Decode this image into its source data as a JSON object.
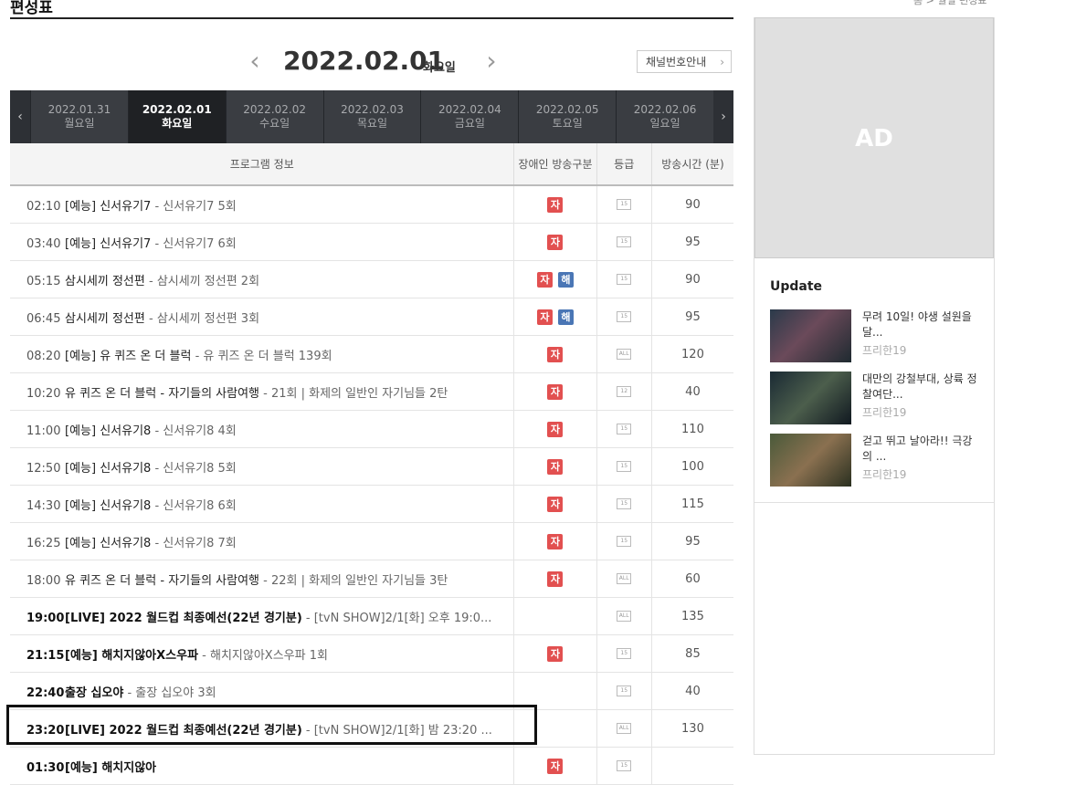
{
  "header": {
    "title": "편성표",
    "breadcrumb": "홈 > 월별 편성표"
  },
  "date_nav": {
    "prev": "‹",
    "next": "›",
    "date": "2022.02.01",
    "dow": "화요일",
    "channel_button": "채널번호안내",
    "channel_chev": "›"
  },
  "day_tabs": {
    "prev": "‹",
    "next": "›",
    "items": [
      {
        "date": "2022.01.31",
        "dow": "월요일"
      },
      {
        "date": "2022.02.01",
        "dow": "화요일"
      },
      {
        "date": "2022.02.02",
        "dow": "수요일"
      },
      {
        "date": "2022.02.03",
        "dow": "목요일"
      },
      {
        "date": "2022.02.04",
        "dow": "금요일"
      },
      {
        "date": "2022.02.05",
        "dow": "토요일"
      },
      {
        "date": "2022.02.06",
        "dow": "일요일"
      }
    ]
  },
  "table": {
    "headers": [
      "프로그램 정보",
      "장애인 방송구분",
      "등급",
      "방송시간 (분)"
    ],
    "rows": [
      {
        "time": "02:10",
        "title": "[예능] 신서유기7",
        "desc": " - 신서유기7 5회",
        "ja": "자",
        "hae": "",
        "rating": "15",
        "dur": "90"
      },
      {
        "time": "03:40",
        "title": "[예능] 신서유기7",
        "desc": " - 신서유기7 6회",
        "ja": "자",
        "hae": "",
        "rating": "15",
        "dur": "95"
      },
      {
        "time": "05:15",
        "title": "삼시세끼 정선편",
        "desc": " - 삼시세끼 정선편 2회",
        "ja": "자",
        "hae": "해",
        "rating": "15",
        "dur": "90"
      },
      {
        "time": "06:45",
        "title": "삼시세끼 정선편",
        "desc": " - 삼시세끼 정선편 3회",
        "ja": "자",
        "hae": "해",
        "rating": "15",
        "dur": "95"
      },
      {
        "time": "08:20",
        "title": "[예능] 유 퀴즈 온 더 블럭",
        "desc": " - 유 퀴즈 온 더 블럭 139회",
        "ja": "자",
        "hae": "",
        "rating": "ALL",
        "dur": "120"
      },
      {
        "time": "10:20",
        "title": "유 퀴즈 온 더 블럭 - 자기들의 사람여행",
        "desc": " - 21회 | 화제의 일반인 자기님들 2탄",
        "ja": "자",
        "hae": "",
        "rating": "12",
        "dur": "40"
      },
      {
        "time": "11:00",
        "title": "[예능] 신서유기8",
        "desc": " - 신서유기8 4회",
        "ja": "자",
        "hae": "",
        "rating": "15",
        "dur": "110"
      },
      {
        "time": "12:50",
        "title": "[예능] 신서유기8",
        "desc": " - 신서유기8 5회",
        "ja": "자",
        "hae": "",
        "rating": "15",
        "dur": "100"
      },
      {
        "time": "14:30",
        "title": "[예능] 신서유기8",
        "desc": " - 신서유기8 6회",
        "ja": "자",
        "hae": "",
        "rating": "15",
        "dur": "115"
      },
      {
        "time": "16:25",
        "title": "[예능] 신서유기8",
        "desc": " - 신서유기8 7회",
        "ja": "자",
        "hae": "",
        "rating": "15",
        "dur": "95"
      },
      {
        "time": "18:00",
        "title": "유 퀴즈 온 더 블럭 - 자기들의 사람여행",
        "desc": " - 22회 | 화제의 일반인 자기님들 3탄",
        "ja": "자",
        "hae": "",
        "rating": "ALL",
        "dur": "60"
      },
      {
        "time": "19:00",
        "title": "[LIVE] 2022 월드컵 최종예선(22년 경기분)",
        "desc": " - [tvN SHOW]2/1[화] 오후 19:0...",
        "ja": "",
        "hae": "",
        "rating": "ALL",
        "dur": "135",
        "bold": true
      },
      {
        "time": "21:15",
        "title": "[예능] 해치지않아X스우파",
        "desc": " - 해치지않아X스우파 1회",
        "ja": "자",
        "hae": "",
        "rating": "15",
        "dur": "85",
        "bold": true
      },
      {
        "time": "22:40",
        "title": "출장 십오야",
        "desc": " - 출장 십오야 3회",
        "ja": "",
        "hae": "",
        "rating": "15",
        "dur": "40",
        "bold": true
      },
      {
        "time": "23:20",
        "title": "[LIVE] 2022 월드컵 최종예선(22년 경기분)",
        "desc": " - [tvN SHOW]2/1[화] 밤 23:20 ...",
        "ja": "",
        "hae": "",
        "rating": "ALL",
        "dur": "130",
        "bold": true
      },
      {
        "time": "01:30",
        "title": "[예능] 해치지않아",
        "desc": "",
        "ja": "자",
        "hae": "",
        "rating": "15",
        "dur": "",
        "bold": true
      }
    ]
  },
  "sidebar": {
    "ad_label": "AD",
    "update_title": "Update",
    "updates": [
      {
        "text": "무려 10일! 야생 설원을 달...",
        "sub": "프리한19"
      },
      {
        "text": "대만의 강철부대, 상륙 정찰여단...",
        "sub": "프리한19"
      },
      {
        "text": "걷고 뛰고 날아라!! 극강의 ...",
        "sub": "프리한19"
      }
    ]
  }
}
